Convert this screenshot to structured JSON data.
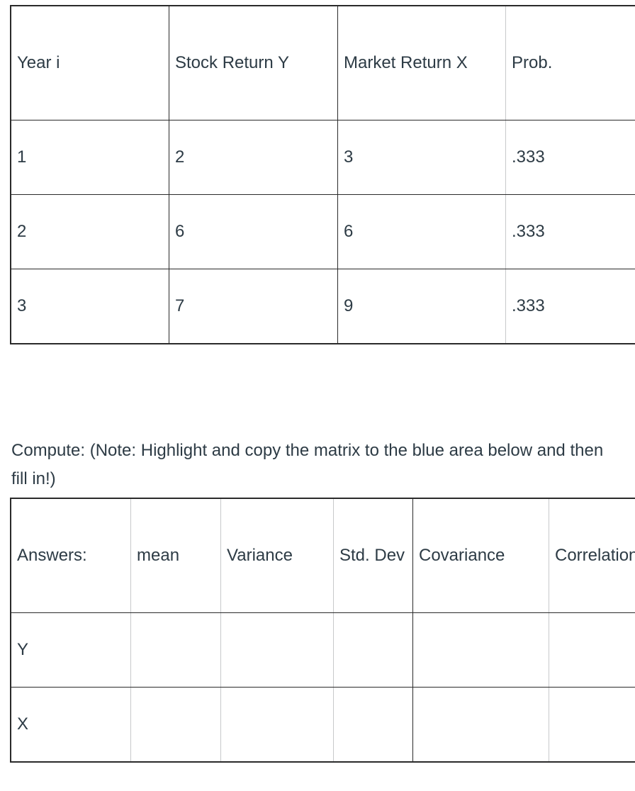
{
  "returns_table": {
    "name": "stock-and-market-returns",
    "headers": [
      "Year i",
      "Stock Return Y",
      "Market Return X",
      "Prob."
    ],
    "rows": [
      [
        "1",
        "2",
        "3",
        ".333"
      ],
      [
        "2",
        "6",
        "6",
        ".333"
      ],
      [
        "3",
        "7",
        "9",
        ".333"
      ]
    ]
  },
  "compute_note": {
    "text": "Compute: (Note: Highlight and copy the matrix to the blue area below and then fill in!)"
  },
  "answers_table": {
    "name": "answers-matrix",
    "headers": [
      "Answers:",
      "mean",
      "Variance",
      "Std. Dev",
      "Covariance",
      "Correlation"
    ],
    "rows": [
      [
        "Y",
        "",
        "",
        "",
        "",
        ""
      ],
      [
        "X",
        "",
        "",
        "",
        "",
        ""
      ]
    ]
  },
  "colors": {
    "text": "#2D3B45",
    "table_border": "#2a2a2a",
    "grid_light": "#c7c9cb",
    "background": "#ffffff"
  }
}
